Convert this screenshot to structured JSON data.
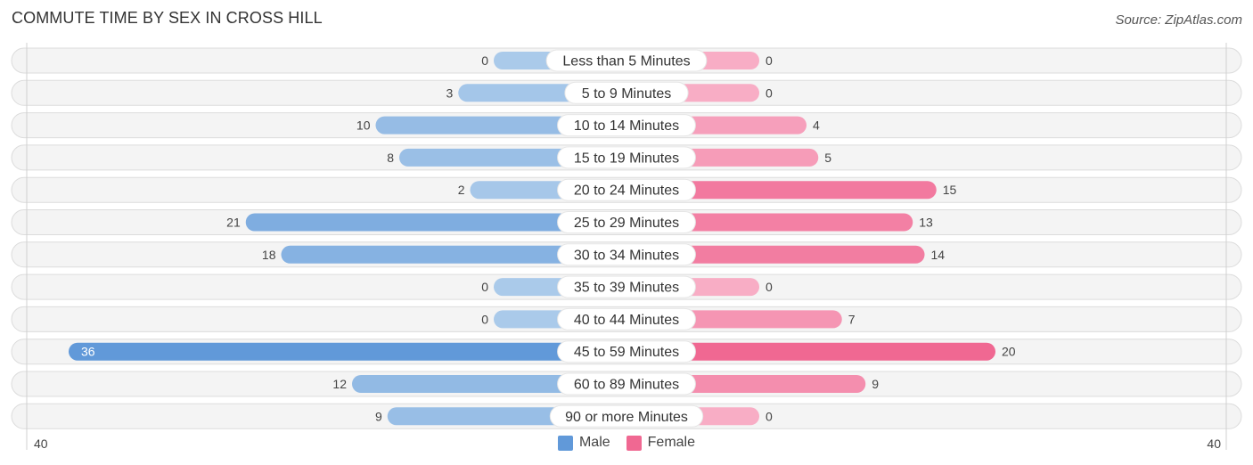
{
  "header": {
    "title": "COMMUTE TIME BY SEX IN CROSS HILL",
    "source": "Source: ZipAtlas.com"
  },
  "legend": {
    "male_label": "Male",
    "female_label": "Female"
  },
  "colors": {
    "male_strong": "#6199d9",
    "male_light": "#aacaea",
    "female_strong": "#f06892",
    "female_light": "#f8adc5"
  },
  "chart_data": {
    "type": "bar",
    "orientation": "horizontal-diverging",
    "title": "COMMUTE TIME BY SEX IN CROSS HILL",
    "categories": [
      "Less than 5 Minutes",
      "5 to 9 Minutes",
      "10 to 14 Minutes",
      "15 to 19 Minutes",
      "20 to 24 Minutes",
      "25 to 29 Minutes",
      "30 to 34 Minutes",
      "35 to 39 Minutes",
      "40 to 44 Minutes",
      "45 to 59 Minutes",
      "60 to 89 Minutes",
      "90 or more Minutes"
    ],
    "series": [
      {
        "name": "Male",
        "values": [
          0,
          3,
          10,
          8,
          2,
          21,
          18,
          0,
          0,
          36,
          12,
          9
        ]
      },
      {
        "name": "Female",
        "values": [
          0,
          0,
          4,
          5,
          15,
          13,
          14,
          0,
          7,
          20,
          9,
          0
        ]
      }
    ],
    "axis": {
      "left_label": "40",
      "right_label": "40",
      "range": [
        0,
        40
      ]
    },
    "legend_position": "bottom-center"
  }
}
